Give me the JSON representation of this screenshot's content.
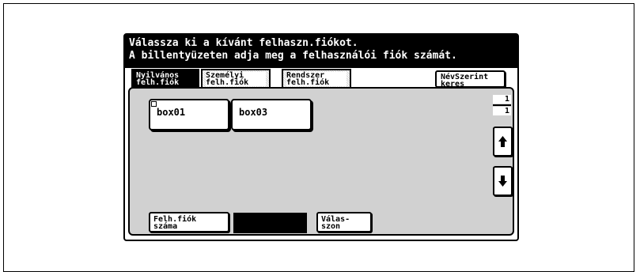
{
  "message": {
    "line1": "Válassza ki a kívánt felhaszn.fiókot.",
    "line2": "A billentyüzeten adja meg a felhasználói fiók számát."
  },
  "tabs": [
    {
      "line1": "Nyilvános",
      "line2": "felh.fiók",
      "active": true
    },
    {
      "line1": "Személyi",
      "line2": "felh.fiók",
      "active": false
    },
    {
      "line1": "Rendszer",
      "line2": "felh.fiók",
      "active": false
    }
  ],
  "search_button": {
    "line1": "NévSzerint",
    "line2": "keres"
  },
  "boxes": [
    {
      "label": "box01"
    },
    {
      "label": "box03"
    }
  ],
  "pager": {
    "current": "1",
    "total": "1"
  },
  "footer": {
    "account_number_line1": "Felh.fiók",
    "account_number_line2": "száma",
    "answer_line1": "Válas-",
    "answer_line2": "szon"
  },
  "colors": {
    "background": "#ffffff",
    "ink": "#000000",
    "panel": "#e6e6e6"
  }
}
